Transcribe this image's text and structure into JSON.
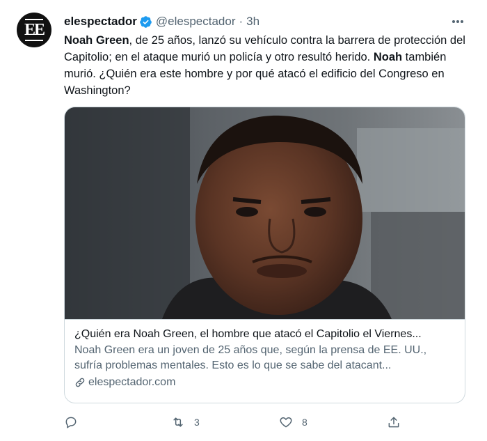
{
  "account": {
    "name": "elespectador",
    "handle": "@elespectador",
    "separator": "·",
    "time": "3h",
    "avatar_text": "EE"
  },
  "tweet": {
    "p1_bold": "Noah Green",
    "p1": ", de 25 años, lanzó su vehículo contra la barrera de protección del Capitolio; en el ataque murió un policía y otro resultó herido. ",
    "p2_bold": "Noah",
    "p2": " también murió. ¿Quién era este hombre y por qué atacó el edificio del Congreso en Washington?"
  },
  "card": {
    "title": "¿Quién era Noah Green, el hombre que atacó el Capitolio el Viernes...",
    "description": "Noah Green era un joven de 25 años que, según la prensa de EE. UU., sufría problemas mentales. Esto es lo que se sabe del atacant...",
    "domain": "elespectador.com"
  },
  "actions": {
    "reply_count": "",
    "retweet_count": "3",
    "like_count": "8"
  },
  "colors": {
    "verified": "#1d9bf0",
    "secondary_text": "#536471",
    "border": "#cfd9de"
  }
}
